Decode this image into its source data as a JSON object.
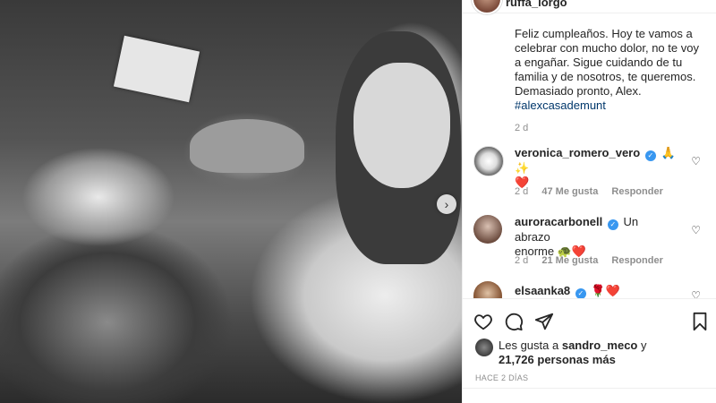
{
  "post": {
    "username": "ruffa_lorgo",
    "caption": "Feliz cumpleaños. Hoy te vamos a celebrar con mucho dolor, no te voy a engañar. Sigue cuidando de tu familia y de nosotros, te queremos. Demasiado pronto, Alex.",
    "hashtag": "#alexcasademunt",
    "time": "2 d"
  },
  "comments": [
    {
      "user": "veronica_romero_vero",
      "verified": true,
      "text": "🙏✨",
      "text2": "❤️",
      "time": "2 d",
      "likes": "47 Me gusta",
      "reply": "Responder"
    },
    {
      "user": "auroracarbonell",
      "verified": true,
      "text": "Un abrazo",
      "text2": "enorme 🐢❤️",
      "time": "2 d",
      "likes": "21 Me gusta",
      "reply": "Responder"
    },
    {
      "user": "elsaanka8",
      "verified": true,
      "text": "🌹❤️"
    }
  ],
  "likes": {
    "prefix": "Les gusta a",
    "user": "sandro_meco",
    "connector": "y",
    "count": "21,726 personas más"
  },
  "posted": "HACE 2 DÍAS",
  "icons": [
    "heart-icon",
    "comment-icon",
    "share-icon",
    "bookmark-icon",
    "chevron-right-icon"
  ],
  "colors": {
    "link": "#00376b",
    "verified": "#3897f0",
    "muted": "#8e8e8e"
  }
}
